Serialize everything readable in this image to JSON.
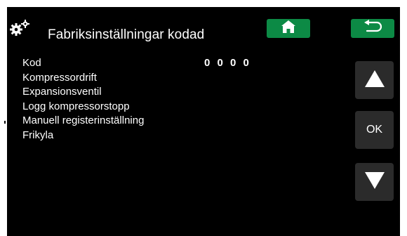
{
  "header": {
    "title": "Fabriksinställningar kodad",
    "icon": "gear-icon",
    "home_icon": "home-icon",
    "back_icon": "back-arrow-icon",
    "accent_color": "#0c8a45"
  },
  "menu": {
    "items": [
      {
        "label": "Kod",
        "value": "0 0 0 0"
      },
      {
        "label": "Kompressordrift"
      },
      {
        "label": "Expansionsventil"
      },
      {
        "label": "Logg kompressorstopp"
      },
      {
        "label": "Manuell registerinställning"
      },
      {
        "label": "Frikyla"
      }
    ]
  },
  "side_buttons": {
    "up_icon": "triangle-up-icon",
    "ok_label": "OK",
    "down_icon": "triangle-down-icon",
    "color": "#2b2b2b"
  }
}
